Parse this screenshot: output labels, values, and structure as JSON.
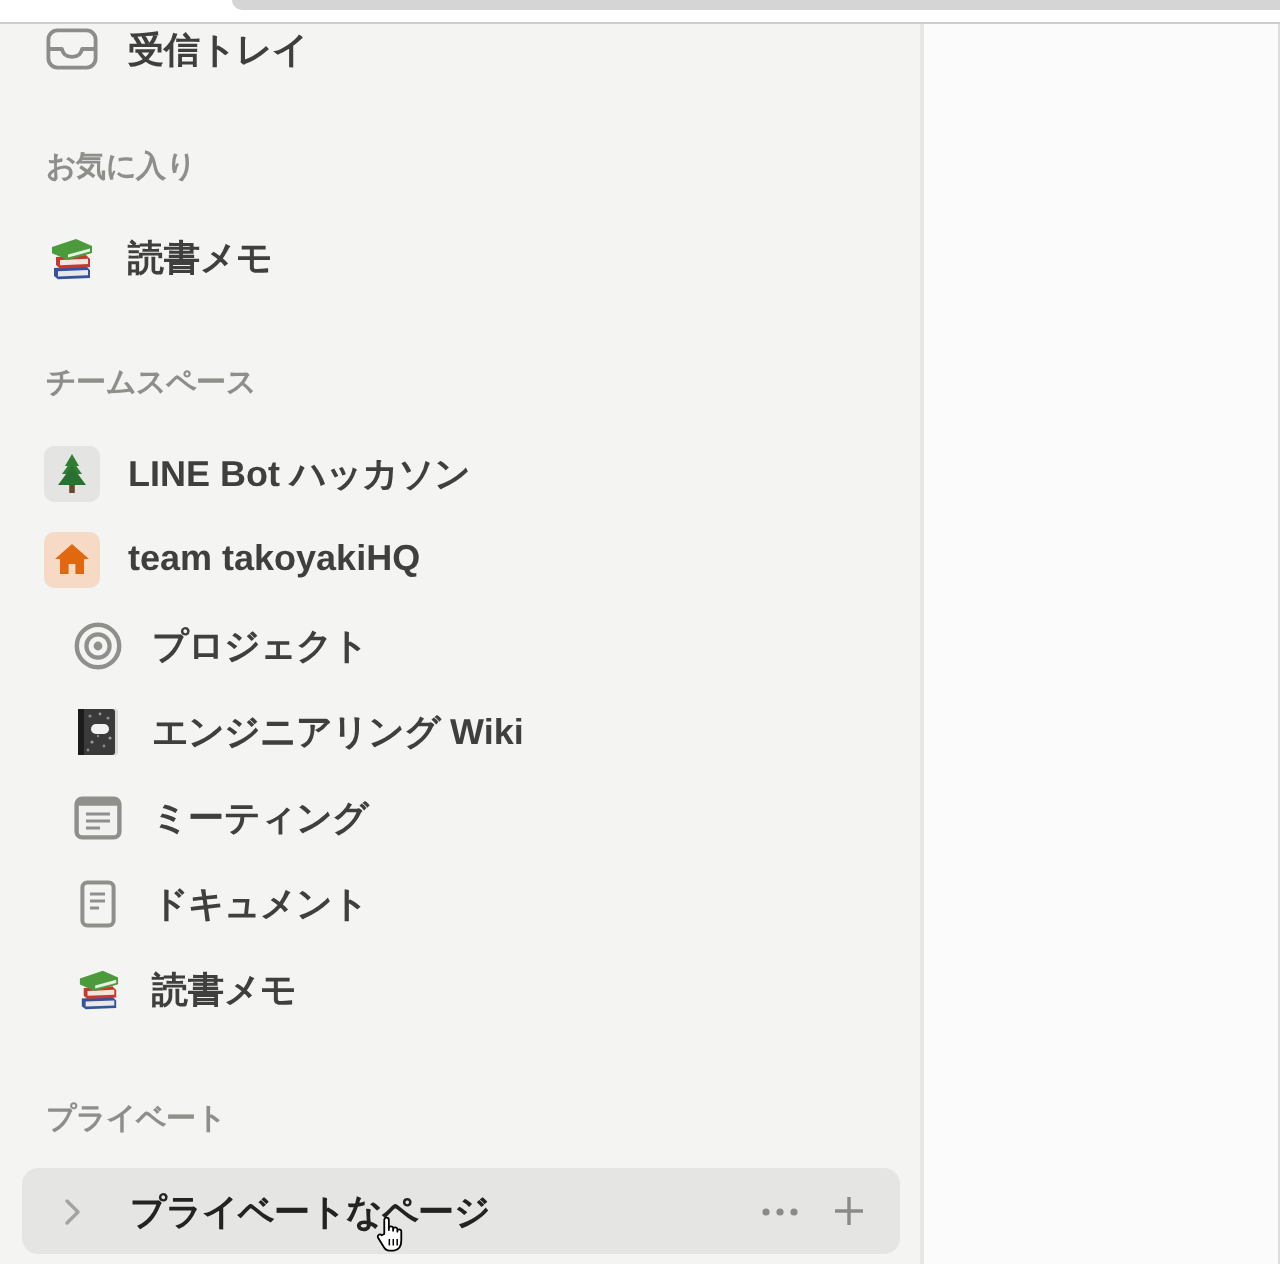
{
  "sidebar": {
    "items": [
      {
        "label": "受信トレイ",
        "kind": "inbox",
        "hovered": false
      }
    ],
    "sections": [
      {
        "title": "お気に入り",
        "items": [
          {
            "label": "読書メモ",
            "kind": "books",
            "hovered": false
          }
        ]
      },
      {
        "title": "チームスペース",
        "items": [
          {
            "label": "LINE Bot ハッカソン",
            "kind": "tree",
            "hovered": false
          },
          {
            "label": "team takoyakiHQ",
            "kind": "house",
            "hovered": false,
            "children": [
              {
                "label": "プロジェクト",
                "kind": "target",
                "hovered": false
              },
              {
                "label": "エンジニアリング Wiki",
                "kind": "notebook",
                "hovered": false
              },
              {
                "label": "ミーティング",
                "kind": "meeting",
                "hovered": false
              },
              {
                "label": "ドキュメント",
                "kind": "document",
                "hovered": false
              },
              {
                "label": "読書メモ",
                "kind": "books",
                "hovered": false
              }
            ]
          }
        ]
      },
      {
        "title": "プライベート",
        "items": [
          {
            "label": "プライベートなページ",
            "kind": "page",
            "hovered": true
          }
        ]
      }
    ]
  }
}
